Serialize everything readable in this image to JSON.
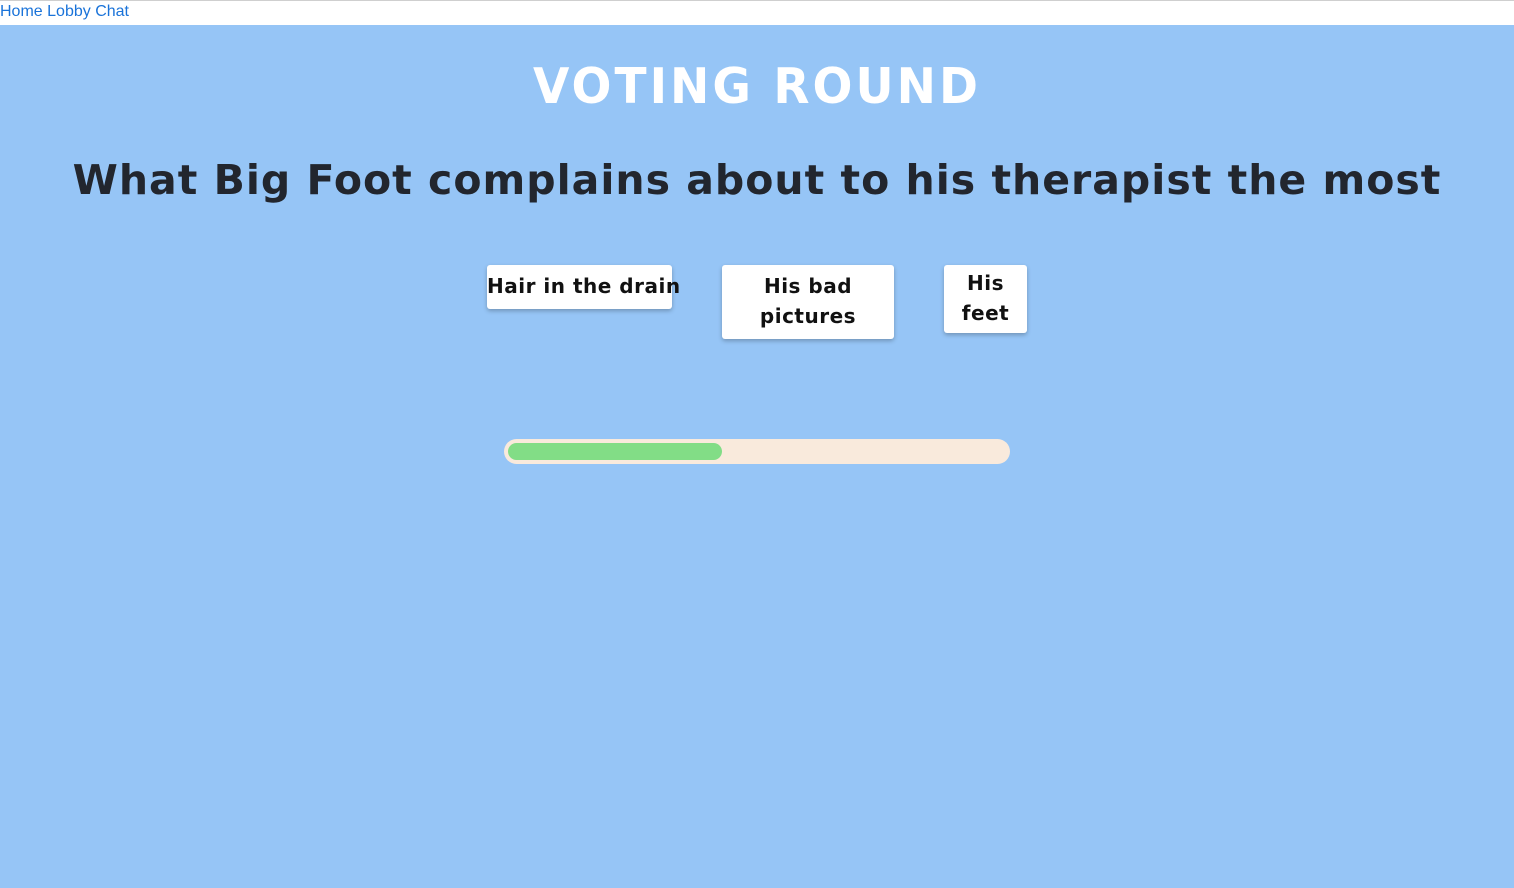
{
  "nav": {
    "links": [
      "Home",
      "Lobby",
      "Chat"
    ]
  },
  "game": {
    "round_title": "VOTING ROUND",
    "prompt": "What Big Foot complains about to his therapist the most",
    "answers": [
      "Hair in the drain",
      "His bad pictures",
      "His feet"
    ]
  },
  "timer": {
    "progress_fraction": 0.43,
    "colors": {
      "track": "#f9eadc",
      "fill": "#82dd86"
    }
  },
  "colors": {
    "background": "#96c5f6",
    "title": "#ffffff",
    "prompt": "#22262e",
    "link": "#1a73d9"
  }
}
